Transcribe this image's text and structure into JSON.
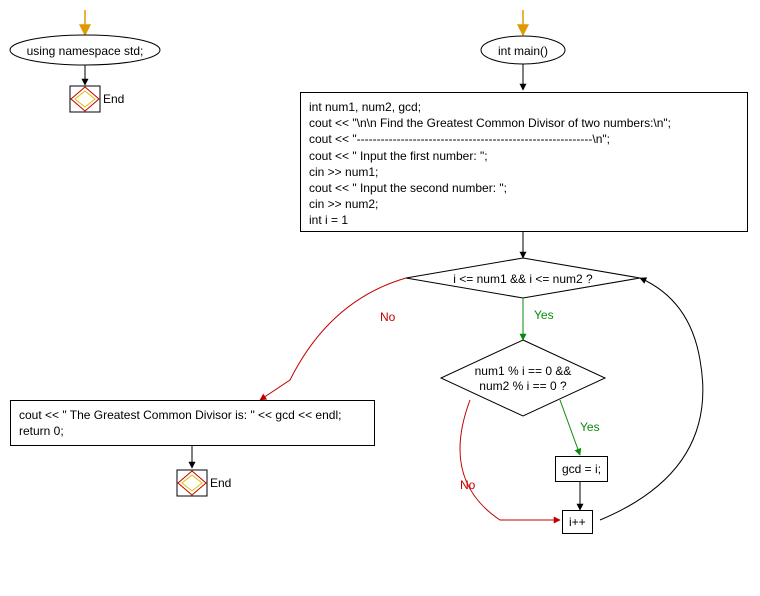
{
  "flowchart": {
    "left_entry": "using namespace std;",
    "main_entry": "int main()",
    "end_label": "End",
    "init_block": {
      "l1": "int num1, num2, gcd;",
      "l2": "cout << \"\\n\\n Find the Greatest Common Divisor of two numbers:\\n\";",
      "l3": "cout << \"-----------------------------------------------------------\\n\";",
      "l4": "cout << \" Input the first number: \";",
      "l5": "cin >> num1;",
      "l6": "cout << \" Input the second number: \";",
      "l7": "cin >> num2;",
      "l8": "int i = 1"
    },
    "decision_outer": "i <= num1 && i <= num2 ?",
    "decision_inner_l1": "num1 % i == 0 &&",
    "decision_inner_l2": "num2 % i == 0 ?",
    "assign_gcd": "gcd = i;",
    "increment": "i++",
    "output_block": {
      "l1": "cout << \" The Greatest Common Divisor is: \" << gcd << endl;",
      "l2": "return 0;"
    },
    "labels": {
      "yes": "Yes",
      "no": "No"
    },
    "colors": {
      "yes": "#0a8a0a",
      "no": "#c00000",
      "entry_arrow": "#e09a00",
      "end_outer": "#c00000",
      "end_inner": "#e0c000"
    }
  }
}
